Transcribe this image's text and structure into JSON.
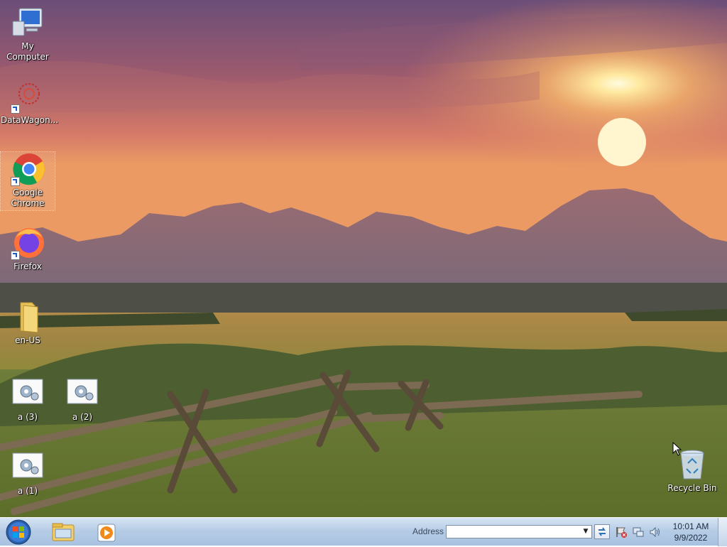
{
  "desktop": {
    "icons": [
      {
        "label": "My Computer"
      },
      {
        "label": "DataWagon..."
      },
      {
        "label": "Google Chrome"
      },
      {
        "label": "Firefox"
      },
      {
        "label": "en-US"
      },
      {
        "label": "a (3)"
      },
      {
        "label": "a (2)"
      },
      {
        "label": "a (1)"
      },
      {
        "label": "Recycle Bin"
      }
    ]
  },
  "taskbar": {
    "address_label": "Address",
    "address_value": "",
    "clock": {
      "time": "10:01 AM",
      "date": "9/9/2022"
    },
    "pinned": [
      "windows-explorer-icon",
      "media-player-icon"
    ]
  },
  "colors": {
    "taskbar": "#b7cde6",
    "sky_top": "#6c4f78",
    "sky_glow": "#f29a5e"
  }
}
